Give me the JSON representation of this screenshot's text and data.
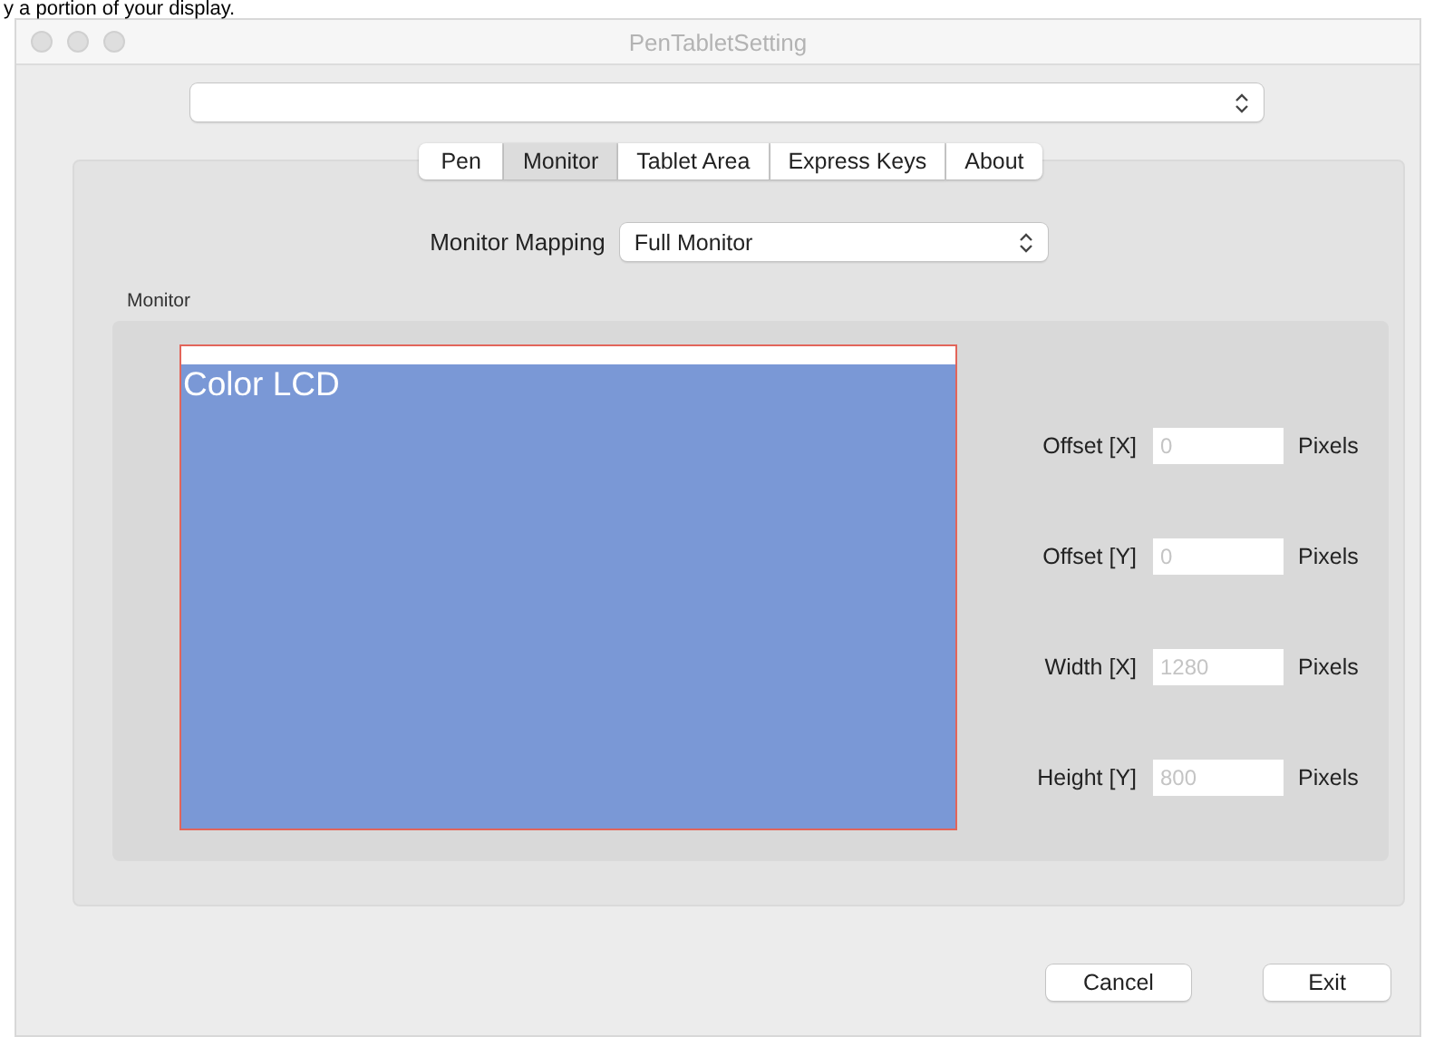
{
  "background_text": "y a portion of your display.",
  "window": {
    "title": "PenTabletSetting"
  },
  "tabs": [
    {
      "label": "Pen",
      "selected": false
    },
    {
      "label": "Monitor",
      "selected": true
    },
    {
      "label": "Tablet Area",
      "selected": false
    },
    {
      "label": "Express Keys",
      "selected": false
    },
    {
      "label": "About",
      "selected": false
    }
  ],
  "mapping": {
    "label": "Monitor Mapping",
    "value": "Full Monitor"
  },
  "monitor_group": {
    "label": "Monitor",
    "display_name": "Color LCD"
  },
  "fields": [
    {
      "label": "Offset [X]",
      "placeholder": "0",
      "unit": "Pixels"
    },
    {
      "label": "Offset [Y]",
      "placeholder": "0",
      "unit": "Pixels"
    },
    {
      "label": "Width [X]",
      "placeholder": "1280",
      "unit": "Pixels"
    },
    {
      "label": "Height [Y]",
      "placeholder": "800",
      "unit": "Pixels"
    }
  ],
  "buttons": [
    "Cancel",
    "Exit"
  ]
}
